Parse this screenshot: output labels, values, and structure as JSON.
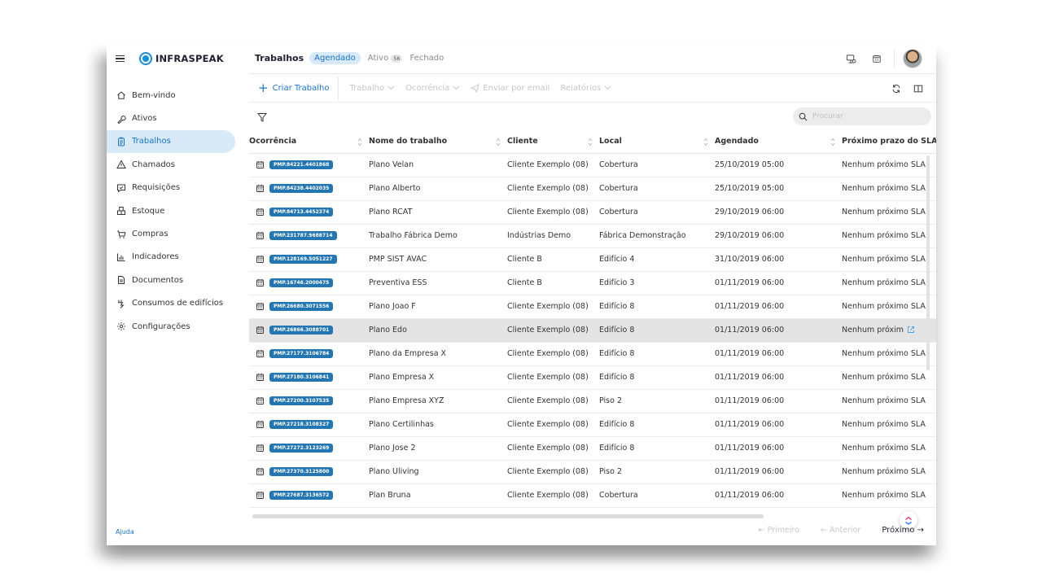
{
  "brand": {
    "name": "INFRASPEAK",
    "color": "#1a8ed6"
  },
  "sidebar": {
    "items": [
      {
        "label": "Bem-vindo",
        "icon": "home-icon",
        "active": false
      },
      {
        "label": "Ativos",
        "icon": "wrench-icon",
        "active": false
      },
      {
        "label": "Trabalhos",
        "icon": "clipboard-icon",
        "active": true
      },
      {
        "label": "Chamados",
        "icon": "alert-triangle-icon",
        "active": false
      },
      {
        "label": "Requisições",
        "icon": "chat-icon",
        "active": false
      },
      {
        "label": "Estoque",
        "icon": "boxes-icon",
        "active": false
      },
      {
        "label": "Compras",
        "icon": "cart-icon",
        "active": false
      },
      {
        "label": "Indicadores",
        "icon": "bar-chart-icon",
        "active": false
      },
      {
        "label": "Documentos",
        "icon": "document-icon",
        "active": false
      },
      {
        "label": "Consumos de edifícios",
        "icon": "energy-icon",
        "active": false
      },
      {
        "label": "Configurações",
        "icon": "gear-icon",
        "active": false
      }
    ],
    "help": "Ajuda"
  },
  "header": {
    "title": "Trabalhos",
    "tabs": [
      {
        "label": "Agendado",
        "active": true
      },
      {
        "label": "Ativo",
        "count": "56",
        "active": false
      },
      {
        "label": "Fechado",
        "active": false
      }
    ]
  },
  "toolbar": {
    "create": "Criar Trabalho",
    "items": [
      "Trabalho",
      "Ocorrência",
      "Enviar por email",
      "Relatórios"
    ]
  },
  "search": {
    "placeholder": "Procurar"
  },
  "table": {
    "columns": [
      "Ocorrência",
      "Nome do trabalho",
      "Cliente",
      "Local",
      "Agendado",
      "Próximo prazo do SLA"
    ],
    "rows": [
      {
        "code": "PMP.84221.4401868",
        "name": "Plano Velan",
        "client": "Cliente Exemplo (08)",
        "local": "Cobertura",
        "scheduled": "25/10/2019 05:00",
        "sla": "Nenhum próximo SLA"
      },
      {
        "code": "PMP.84238.4402035",
        "name": "Plano Alberto",
        "client": "Cliente Exemplo (08)",
        "local": "Cobertura",
        "scheduled": "25/10/2019 05:00",
        "sla": "Nenhum próximo SLA"
      },
      {
        "code": "PMP.84713.4452374",
        "name": "Plano RCAT",
        "client": "Cliente Exemplo (08)",
        "local": "Cobertura",
        "scheduled": "29/10/2019 06:00",
        "sla": "Nenhum próximo SLA"
      },
      {
        "code": "PMP.231787.9688714",
        "name": "Trabalho Fábrica Demo",
        "client": "Indústrias Demo",
        "local": "Fábrica Demonstração",
        "scheduled": "29/10/2019 06:00",
        "sla": "Nenhum próximo SLA"
      },
      {
        "code": "PMP.128169.5051227",
        "name": "PMP SIST AVAC",
        "client": "Cliente B",
        "local": "Edifício 4",
        "scheduled": "31/10/2019 06:00",
        "sla": "Nenhum próximo SLA"
      },
      {
        "code": "PMP.16746.2000475",
        "name": "Preventiva ESS",
        "client": "Cliente B",
        "local": "Edifício 3",
        "scheduled": "01/11/2019 06:00",
        "sla": "Nenhum próximo SLA"
      },
      {
        "code": "PMP.26680.3071556",
        "name": "Plano Joao F",
        "client": "Cliente Exemplo (08)",
        "local": "Edifício 8",
        "scheduled": "01/11/2019 06:00",
        "sla": "Nenhum próximo SLA"
      },
      {
        "code": "PMP.26866.3088701",
        "name": "Plano Edo",
        "client": "Cliente Exemplo (08)",
        "local": "Edifício 8",
        "scheduled": "01/11/2019 06:00",
        "sla": "Nenhum próxim",
        "highlighted": true
      },
      {
        "code": "PMP.27177.3106784",
        "name": "Plano da Empresa X",
        "client": "Cliente Exemplo (08)",
        "local": "Edifício 8",
        "scheduled": "01/11/2019 06:00",
        "sla": "Nenhum próximo SLA"
      },
      {
        "code": "PMP.27180.3106841",
        "name": "Plano Empresa X",
        "client": "Cliente Exemplo (08)",
        "local": "Edifício 8",
        "scheduled": "01/11/2019 06:00",
        "sla": "Nenhum próximo SLA"
      },
      {
        "code": "PMP.27200.3107535",
        "name": "Plano Empresa XYZ",
        "client": "Cliente Exemplo (08)",
        "local": "Piso 2",
        "scheduled": "01/11/2019 06:00",
        "sla": "Nenhum próximo SLA"
      },
      {
        "code": "PMP.27218.3108327",
        "name": "Plano Certilinhas",
        "client": "Cliente Exemplo (08)",
        "local": "Edifício 8",
        "scheduled": "01/11/2019 06:00",
        "sla": "Nenhum próximo SLA"
      },
      {
        "code": "PMP.27272.3123269",
        "name": "Plano Jose 2",
        "client": "Cliente Exemplo (08)",
        "local": "Edifício 8",
        "scheduled": "01/11/2019 06:00",
        "sla": "Nenhum próximo SLA"
      },
      {
        "code": "PMP.27370.3125800",
        "name": "Plano Uliving",
        "client": "Cliente Exemplo (08)",
        "local": "Piso 2",
        "scheduled": "01/11/2019 06:00",
        "sla": "Nenhum próximo SLA"
      },
      {
        "code": "PMP.27687.3136572",
        "name": "Plan Bruna",
        "client": "Cliente Exemplo (08)",
        "local": "Cobertura",
        "scheduled": "01/11/2019 06:00",
        "sla": "Nenhum próximo SLA"
      }
    ]
  },
  "pagination": {
    "first": "Primeiro",
    "prev": "Anterior",
    "next": "Próximo"
  },
  "colors": {
    "accent": "#1a73c7",
    "code_badge": "#2476b3",
    "active_bg": "#d8e9f7"
  }
}
